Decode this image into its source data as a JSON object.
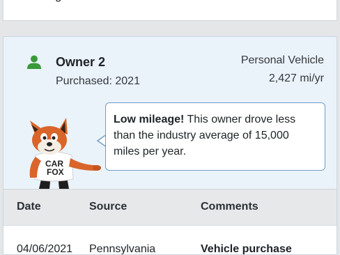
{
  "previous_card": {
    "cut_text": "g"
  },
  "owner": {
    "title": "Owner 2",
    "purchased": "Purchased: 2021",
    "vehicle_type": "Personal Vehicle",
    "mileage": "2,427 mi/yr",
    "icon": "person-icon",
    "icon_color": "#3a9a3a"
  },
  "callout": {
    "lead": "Low mileage!",
    "text": " This owner drove less than the industry average of 15,000 miles per year."
  },
  "mascot": {
    "shirt_line1": "CAR",
    "shirt_line2": "FOX"
  },
  "table": {
    "headers": [
      "Date",
      "Source",
      "Comments"
    ],
    "rows": [
      [
        "04/06/2021",
        "Pennsylvania",
        "Vehicle purchase"
      ]
    ]
  }
}
